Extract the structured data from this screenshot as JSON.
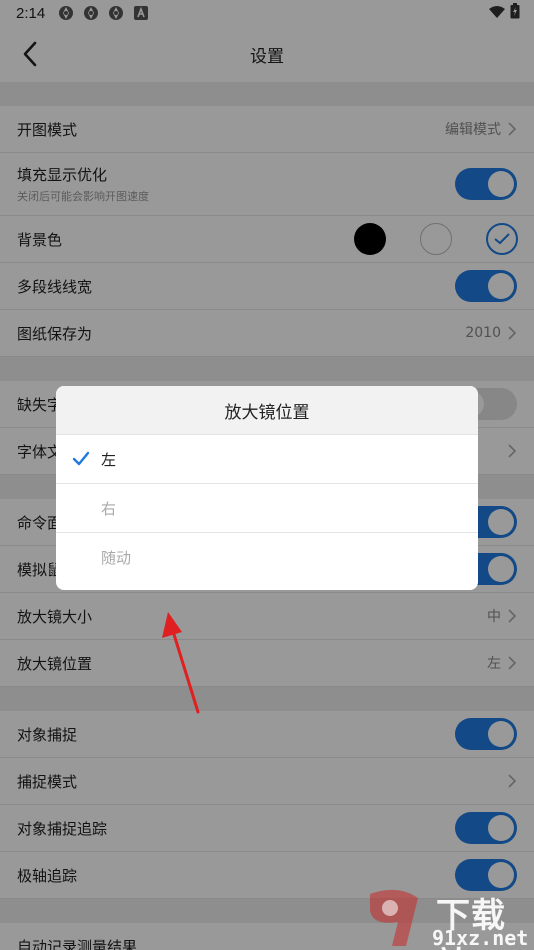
{
  "status_bar": {
    "time": "2:14",
    "icons": [
      "sync-icon",
      "sync-icon",
      "sync-icon",
      "a-badge-icon"
    ],
    "right_icons": [
      "wifi-icon",
      "battery-icon"
    ]
  },
  "nav": {
    "title": "设置",
    "back_icon": "chevron-left-icon"
  },
  "rows": {
    "open_mode": {
      "label": "开图模式",
      "value": "编辑模式"
    },
    "fill_display": {
      "label": "填充显示优化",
      "sub": "关闭后可能会影响开图速度",
      "on": true
    },
    "background": {
      "label": "背景色",
      "colors": [
        "#000000",
        "#ffffff",
        "#ffffff"
      ],
      "selected": 2
    },
    "polyline_width": {
      "label": "多段线线宽",
      "on": true
    },
    "save_as": {
      "label": "图纸保存为",
      "value": "2010"
    },
    "missing_font": {
      "label": "缺失字",
      "on": false
    },
    "font_file": {
      "label": "字体文"
    },
    "command": {
      "label": "命令面",
      "on": true
    },
    "simulate": {
      "label": "模拟鼠",
      "on": true
    },
    "magnifier_size": {
      "label": "放大镜大小",
      "value": "中"
    },
    "magnifier_position": {
      "label": "放大镜位置",
      "value": "左"
    },
    "object_snap": {
      "label": "对象捕捉",
      "on": true
    },
    "snap_mode": {
      "label": "捕捉模式"
    },
    "snap_tracking": {
      "label": "对象捕捉追踪",
      "on": true
    },
    "polar_tracking": {
      "label": "极轴追踪",
      "on": true
    },
    "auto_record": {
      "label": "自动记录测量结果"
    }
  },
  "dialog": {
    "title": "放大镜位置",
    "options": [
      {
        "label": "左",
        "selected": true
      },
      {
        "label": "右",
        "selected": false
      },
      {
        "label": "随动",
        "selected": false
      }
    ]
  },
  "watermark": {
    "top": "下载站",
    "bottom": "91xz.net"
  },
  "colors": {
    "accent": "#1e7ae0",
    "arrow": "#e02020",
    "dim_overlay": "rgba(0,0,0,0.4)"
  }
}
